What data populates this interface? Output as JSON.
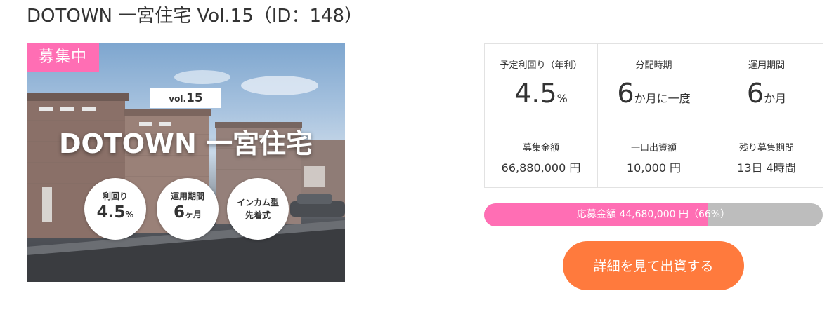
{
  "page_title": "DOTOWN 一宮住宅 Vol.15（ID：148）",
  "hero": {
    "status_badge": "募集中",
    "vol_prefix": "vol.",
    "vol_number": "15",
    "title": "DOTOWN 一宮住宅",
    "circles": {
      "yield_label": "利回り",
      "yield_value": "4.5",
      "yield_unit": "%",
      "period_label": "運用期間",
      "period_value": "6",
      "period_unit": "ヶ月",
      "type_line1": "インカム型",
      "type_line2": "先着式"
    }
  },
  "info": {
    "expected_yield": {
      "label": "予定利回り（年利）",
      "value": "4.5",
      "unit": "%"
    },
    "distribution": {
      "label": "分配時期",
      "value": "6",
      "unit": "か月に一度"
    },
    "operation_period": {
      "label": "運用期間",
      "value": "6",
      "unit": "か月"
    },
    "raise_amount": {
      "label": "募集金額",
      "value": "66,880,000 円"
    },
    "unit_investment": {
      "label": "一口出資額",
      "value": "10,000 円"
    },
    "remaining_period": {
      "label": "残り募集期間",
      "value": "13日 4時間"
    }
  },
  "progress": {
    "text": "応募金額 44,680,000 円（66%）",
    "fraction": 0.66,
    "fill_color": "#ff6eb4",
    "track_color": "#bdbdbd"
  },
  "cta": {
    "label": "詳細を見て出資する",
    "color": "#ff7a3d"
  }
}
